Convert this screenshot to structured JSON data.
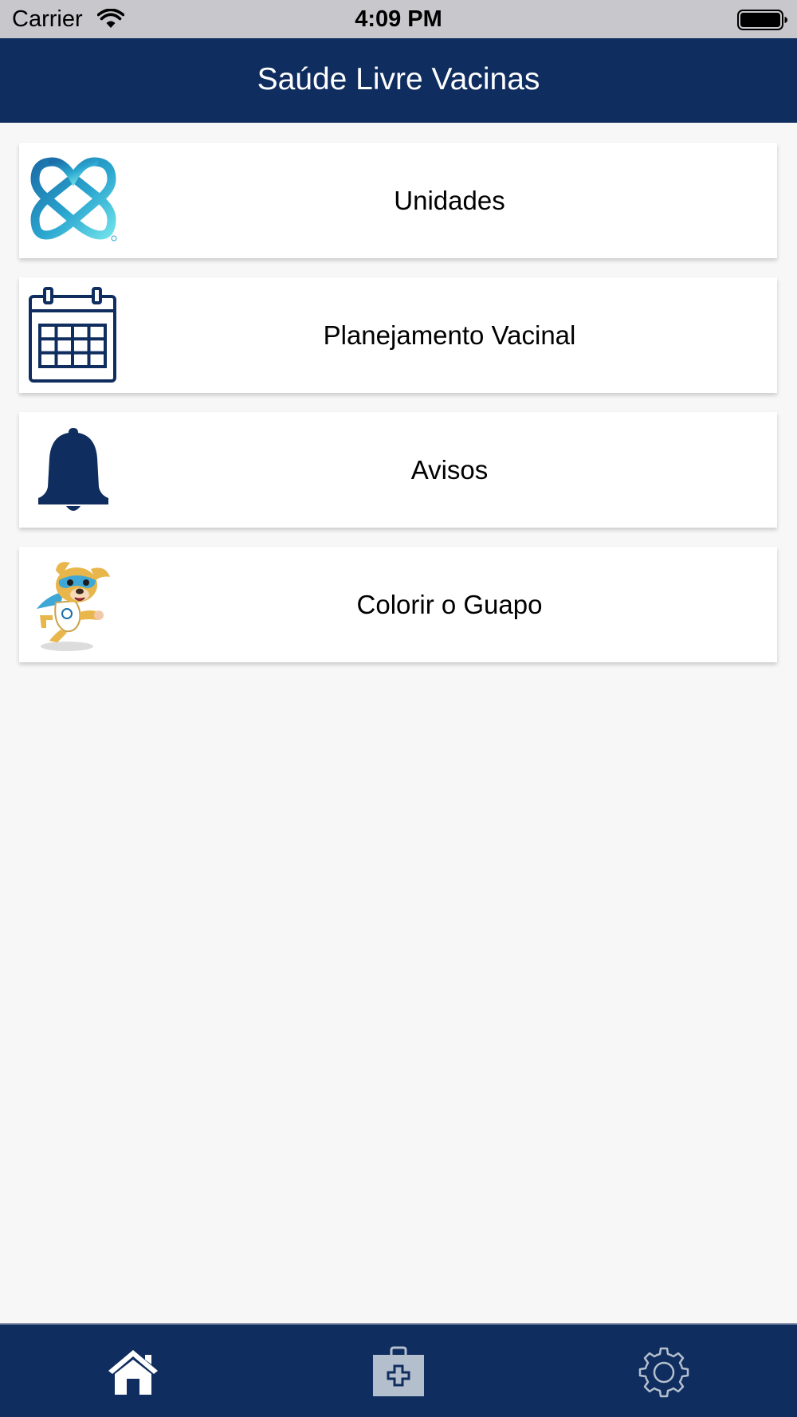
{
  "status_bar": {
    "carrier": "Carrier",
    "time": "4:09 PM",
    "wifi_icon": "wifi-icon",
    "battery_icon": "battery-full-icon"
  },
  "header": {
    "title": "Saúde Livre Vacinas",
    "background_color": "#0f2d5f"
  },
  "menu": {
    "items": [
      {
        "label": "Unidades",
        "icon": "brand-logo-icon"
      },
      {
        "label": "Planejamento Vacinal",
        "icon": "calendar-icon"
      },
      {
        "label": "Avisos",
        "icon": "bell-icon"
      },
      {
        "label": "Colorir o Guapo",
        "icon": "guapo-mascot-icon"
      }
    ]
  },
  "tab_bar": {
    "tabs": [
      {
        "icon": "home-icon",
        "selected": true
      },
      {
        "icon": "medical-kit-icon",
        "selected": false
      },
      {
        "icon": "gear-icon",
        "selected": false
      }
    ],
    "background_color": "#0f2d5f"
  }
}
